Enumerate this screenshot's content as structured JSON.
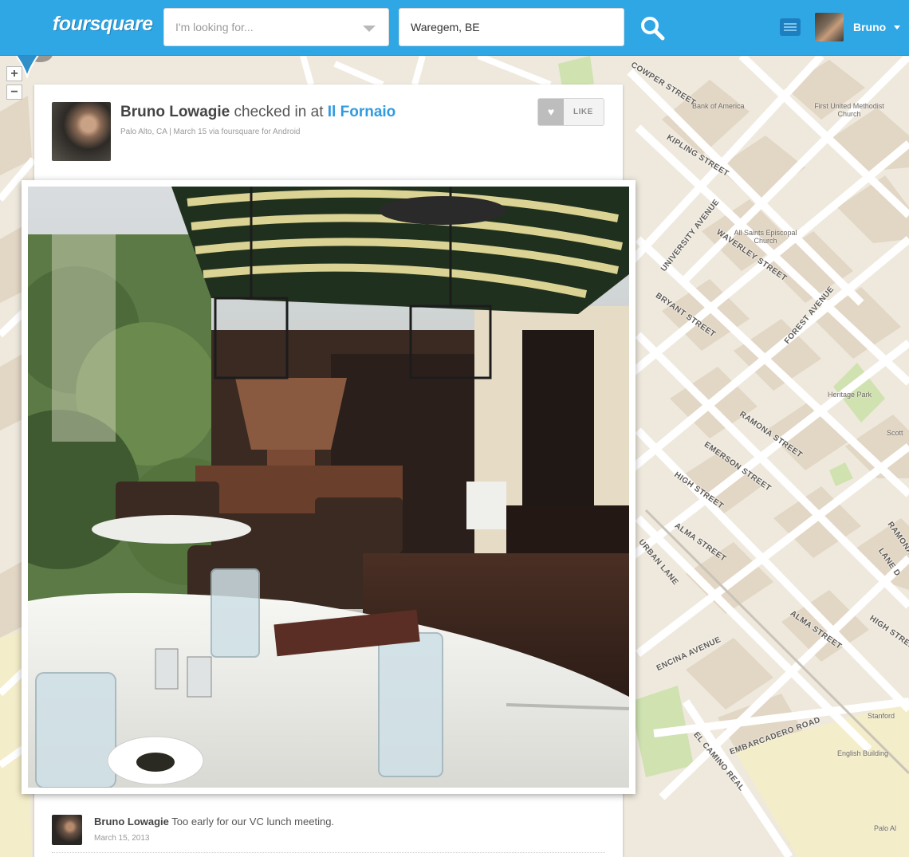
{
  "header": {
    "logo": "foursquare",
    "search_placeholder": "I'm looking for...",
    "location_value": "Waregem, BE",
    "user_name": "Bruno"
  },
  "map": {
    "zoom_in": "+",
    "zoom_out": "−",
    "streets": [
      {
        "name": "COWPER STREET"
      },
      {
        "name": "KIPLING STREET"
      },
      {
        "name": "UNIVERSITY AVENUE"
      },
      {
        "name": "WAVERLEY STREET"
      },
      {
        "name": "BRYANT STREET"
      },
      {
        "name": "FOREST AVENUE"
      },
      {
        "name": "RAMONA STREET"
      },
      {
        "name": "EMERSON STREET"
      },
      {
        "name": "HIGH STREET"
      },
      {
        "name": "ALMA STREET"
      },
      {
        "name": "URBAN LANE"
      },
      {
        "name": "ENCINA AVENUE"
      },
      {
        "name": "EMBARCADERO ROAD"
      },
      {
        "name": "EL CAMINO REAL"
      },
      {
        "name": "ALMA STREET"
      },
      {
        "name": "HIGH STREET"
      },
      {
        "name": "LANE D"
      },
      {
        "name": "RAMONA"
      }
    ],
    "pois": [
      {
        "name": "Bank of America"
      },
      {
        "name": "First United Methodist Church"
      },
      {
        "name": "All Saints Episcopal Church"
      },
      {
        "name": "Heritage Park"
      },
      {
        "name": "Stanford"
      },
      {
        "name": "English Building"
      },
      {
        "name": "Palo Al"
      },
      {
        "name": "Scott"
      }
    ]
  },
  "checkin": {
    "user": "Bruno Lowagie",
    "verb": " checked in at ",
    "venue": "Il Fornaio",
    "meta": "Palo Alto, CA | March 15 via foursquare for Android",
    "like_label": "LIKE",
    "like_icon": "heart-icon"
  },
  "comment": {
    "user": "Bruno Lowagie",
    "text": " Too early for our VC lunch meeting.",
    "date": "March 15, 2013"
  },
  "colors": {
    "header_bg": "#2fa7e5",
    "link": "#2f9be0",
    "map_bg": "#efe9dd",
    "pin": "#2e8fc9"
  }
}
